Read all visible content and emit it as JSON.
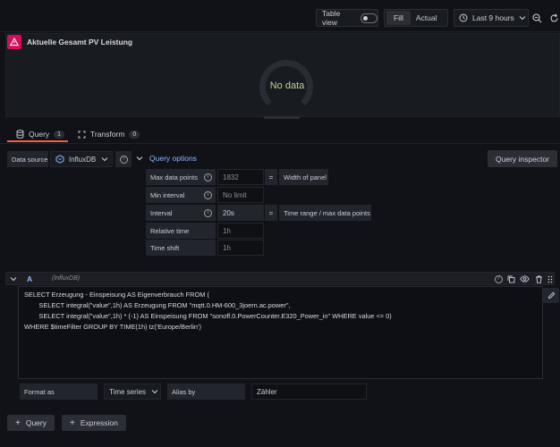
{
  "toolbar": {
    "table_view_label": "Table view",
    "fill_label": "Fill",
    "actual_label": "Actual",
    "time_range_label": "Last 9 hours"
  },
  "panel": {
    "title": "Aktuelle Gesamt PV Leistung",
    "no_data": "No data"
  },
  "tabs": [
    {
      "label": "Query",
      "count": "1"
    },
    {
      "label": "Transform",
      "count": "0"
    }
  ],
  "datasource": {
    "label": "Data source",
    "value": "InfluxDB",
    "query_options_label": "Query options",
    "query_inspector_label": "Query inspector"
  },
  "options": {
    "max_data_points": {
      "label": "Max data points",
      "value": "1832",
      "note": "Width of panel"
    },
    "min_interval": {
      "label": "Min interval",
      "placeholder": "No limit"
    },
    "interval": {
      "label": "Interval",
      "value": "20s",
      "note": "Time range / max data points"
    },
    "relative_time": {
      "label": "Relative time",
      "placeholder": "1h"
    },
    "time_shift": {
      "label": "Time shift",
      "placeholder": "1h"
    }
  },
  "query": {
    "ref_id": "A",
    "datasource_hint": "(InfluxDB)",
    "text": "SELECT Erzeugung - Einspeisung AS Eigenverbrauch FROM (\n        SELECT integral(\"value\",1h) AS Erzeugung FROM \"mqtt.0.HM-600_3joern.ac.power\",\n        SELECT integral(\"value\",1h) * (-1) AS Einspeisung FROM \"sonoff.0.PowerCounter.E320_Power_in\" WHERE value <= 0)\nWHERE $timeFilter GROUP BY TIME(1h) tz('Europe/Berlin')",
    "format_as_label": "Format as",
    "format_as_value": "Time series",
    "alias_by_label": "Alias by",
    "alias_by_value": "Zähler"
  },
  "add_buttons": {
    "query_label": "Query",
    "expression_label": "Expression"
  }
}
